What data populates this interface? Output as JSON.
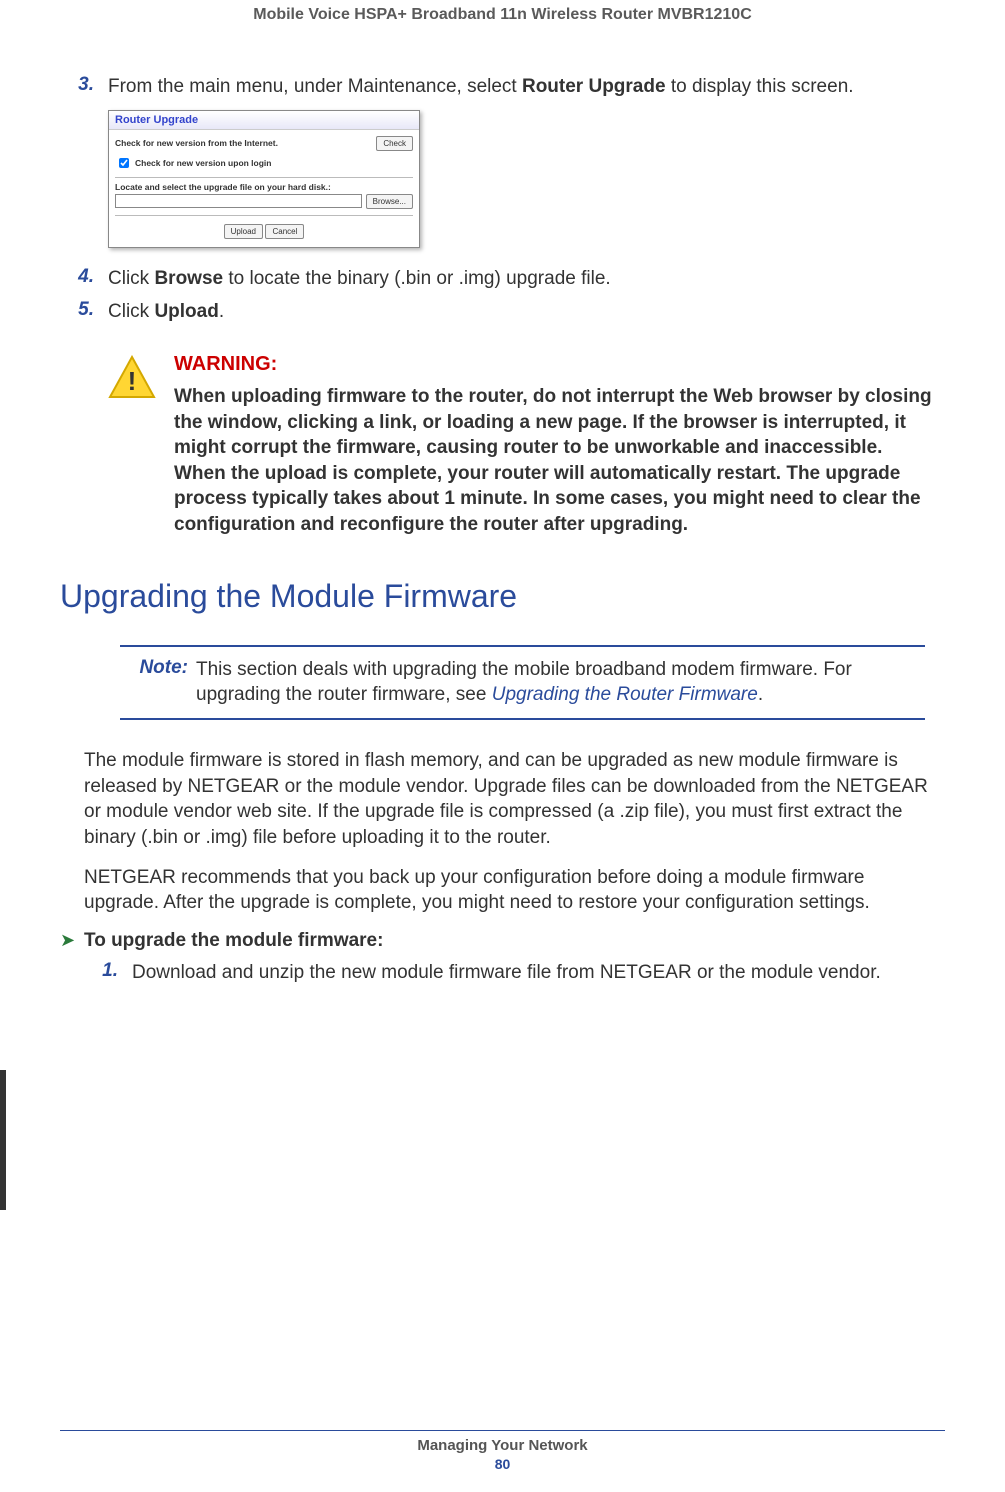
{
  "header": {
    "title": "Mobile Voice HSPA+ Broadband 11n Wireless Router MVBR1210C"
  },
  "steps_a": [
    {
      "num": "3.",
      "before": "From the main menu, under Maintenance, select ",
      "bold": "Router Upgrade",
      "after": " to display this screen."
    },
    {
      "num": "4.",
      "before": "Click ",
      "bold": "Browse",
      "after": " to locate the binary (.bin or .img) upgrade file."
    },
    {
      "num": "5.",
      "before": "Click ",
      "bold": "Upload",
      "after": "."
    }
  ],
  "screenshot": {
    "title": "Router Upgrade",
    "check_internet_label": "Check for new version from the Internet.",
    "check_btn": "Check",
    "check_login_label": "Check for new version upon login",
    "locate_label": "Locate and select the upgrade file on your hard disk.:",
    "browse_btn": "Browse...",
    "upload_btn": "Upload",
    "cancel_btn": "Cancel"
  },
  "warning": {
    "title": "WARNING:",
    "text": "When uploading firmware to the router, do not interrupt the Web browser by closing the window, clicking a link, or loading a new page. If the browser is interrupted, it might corrupt the firmware, causing router to be unworkable and inaccessible. When the upload is complete, your router will automatically restart. The upgrade process typically takes about 1 minute. In some cases, you might need to clear the configuration and reconfigure the router after upgrading."
  },
  "section_heading": "Upgrading the Module Firmware",
  "note": {
    "label": "Note:",
    "text_before": "This section deals with upgrading the mobile broadband modem firmware. For upgrading the router firmware, see ",
    "link": "Upgrading the Router Firmware",
    "text_after": "."
  },
  "paras": [
    "The module firmware is stored in flash memory, and can be upgraded as new module firmware is released by NETGEAR or the module vendor. Upgrade files can be downloaded from the NETGEAR or module vendor web site. If the upgrade file is compressed (a .zip file), you must first extract the binary (.bin or .img) file before uploading it to the router.",
    "NETGEAR recommends that you back up your configuration before doing a module firmware upgrade. After the upgrade is complete, you might need to restore your configuration settings."
  ],
  "proc_heading": "To upgrade the module firmware:",
  "steps_b": [
    {
      "num": "1.",
      "text": "Download and unzip the new module firmware file from NETGEAR or the module vendor."
    }
  ],
  "footer": {
    "section": "Managing Your Network",
    "page": "80"
  }
}
